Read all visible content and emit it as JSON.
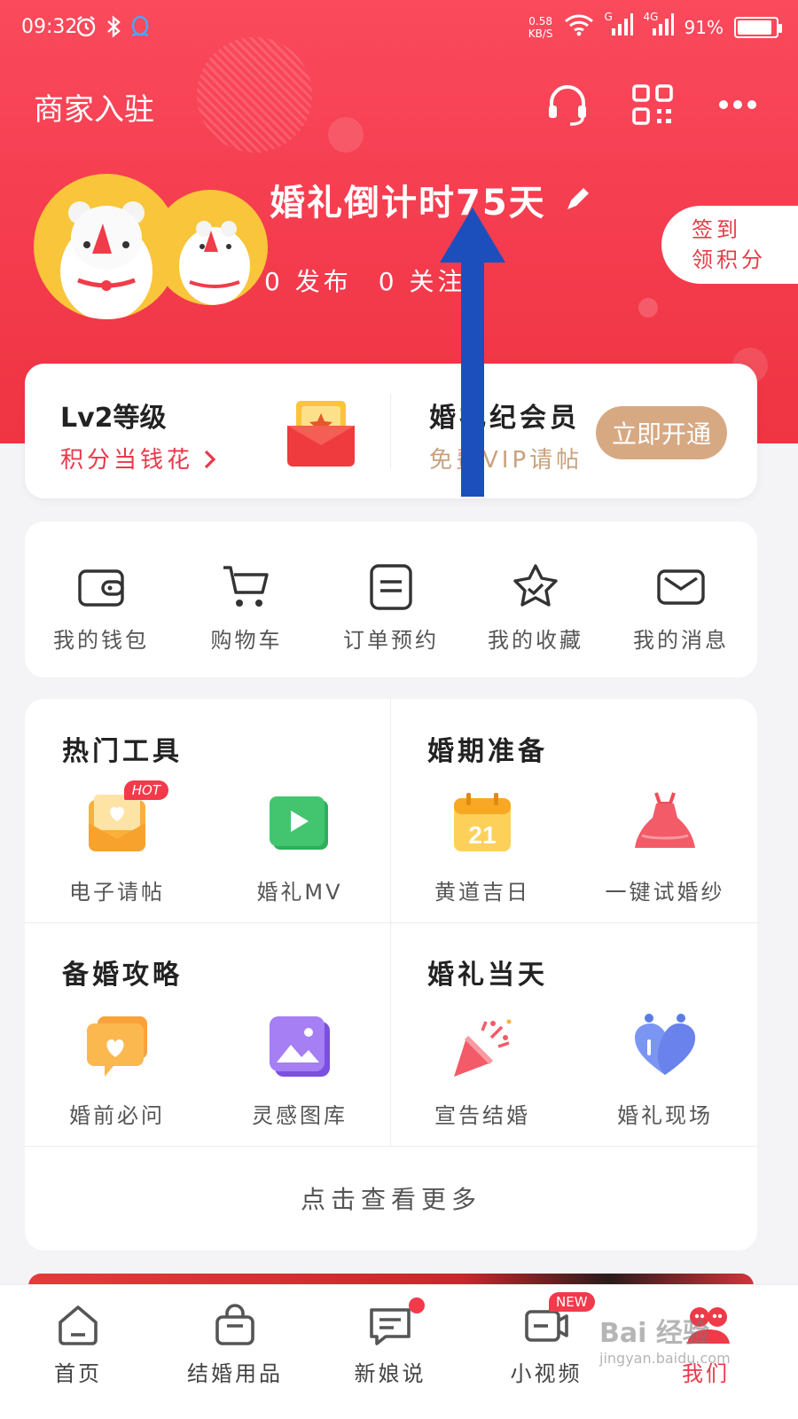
{
  "status_bar": {
    "time": "09:32",
    "net_speed_value": "0.58",
    "net_speed_unit": "KB/S",
    "sim1": "G",
    "sim2": "4G",
    "battery": "91%",
    "battery_level": 0.91
  },
  "header": {
    "merchant_label": "商家入驻",
    "countdown": "婚礼倒计时75天",
    "stats": [
      {
        "count": "0",
        "label": "发布"
      },
      {
        "count": "0",
        "label": "关注"
      }
    ],
    "checkin_line1": "签到",
    "checkin_line2": "领积分"
  },
  "level_card": {
    "level_title": "Lv2等级",
    "level_sub": "积分当钱花",
    "vip_title": "婚礼纪会员",
    "vip_sub": "免费VIP请帖",
    "open_button": "立即开通"
  },
  "quick_actions": [
    {
      "label": "我的钱包",
      "icon": "wallet-icon"
    },
    {
      "label": "购物车",
      "icon": "cart-icon"
    },
    {
      "label": "订单预约",
      "icon": "order-icon"
    },
    {
      "label": "我的收藏",
      "icon": "star-icon"
    },
    {
      "label": "我的消息",
      "icon": "mail-icon"
    }
  ],
  "sections": [
    {
      "title": "热门工具",
      "items": [
        {
          "label": "电子请帖",
          "icon": "invitation-icon",
          "badge": "HOT"
        },
        {
          "label": "婚礼MV",
          "icon": "video-play-icon"
        }
      ]
    },
    {
      "title": "婚期准备",
      "items": [
        {
          "label": "黄道吉日",
          "icon": "calendar-icon",
          "calendar_day": "21"
        },
        {
          "label": "一键试婚纱",
          "icon": "dress-icon"
        }
      ]
    },
    {
      "title": "备婚攻略",
      "items": [
        {
          "label": "婚前必问",
          "icon": "heart-chat-icon"
        },
        {
          "label": "灵感图库",
          "icon": "gallery-icon"
        }
      ]
    },
    {
      "title": "婚礼当天",
      "items": [
        {
          "label": "宣告结婚",
          "icon": "party-popper-icon"
        },
        {
          "label": "婚礼现场",
          "icon": "heart-live-icon"
        }
      ]
    }
  ],
  "more_label": "点击查看更多",
  "tabbar": [
    {
      "label": "首页",
      "icon": "home-icon"
    },
    {
      "label": "结婚用品",
      "icon": "shopping-bag-icon"
    },
    {
      "label": "新娘说",
      "icon": "chat-icon",
      "dot": true
    },
    {
      "label": "小视频",
      "icon": "video-icon",
      "badge": "NEW"
    },
    {
      "label": "我们",
      "icon": "couple-icon",
      "active": true
    }
  ],
  "watermark": {
    "brand": "Bai 经验",
    "url": "jingyan.baidu.com"
  },
  "colors": {
    "brand_red": "#f43c4e",
    "vip_gold": "#d7a983",
    "annotation_arrow": "#1c4fbc"
  }
}
